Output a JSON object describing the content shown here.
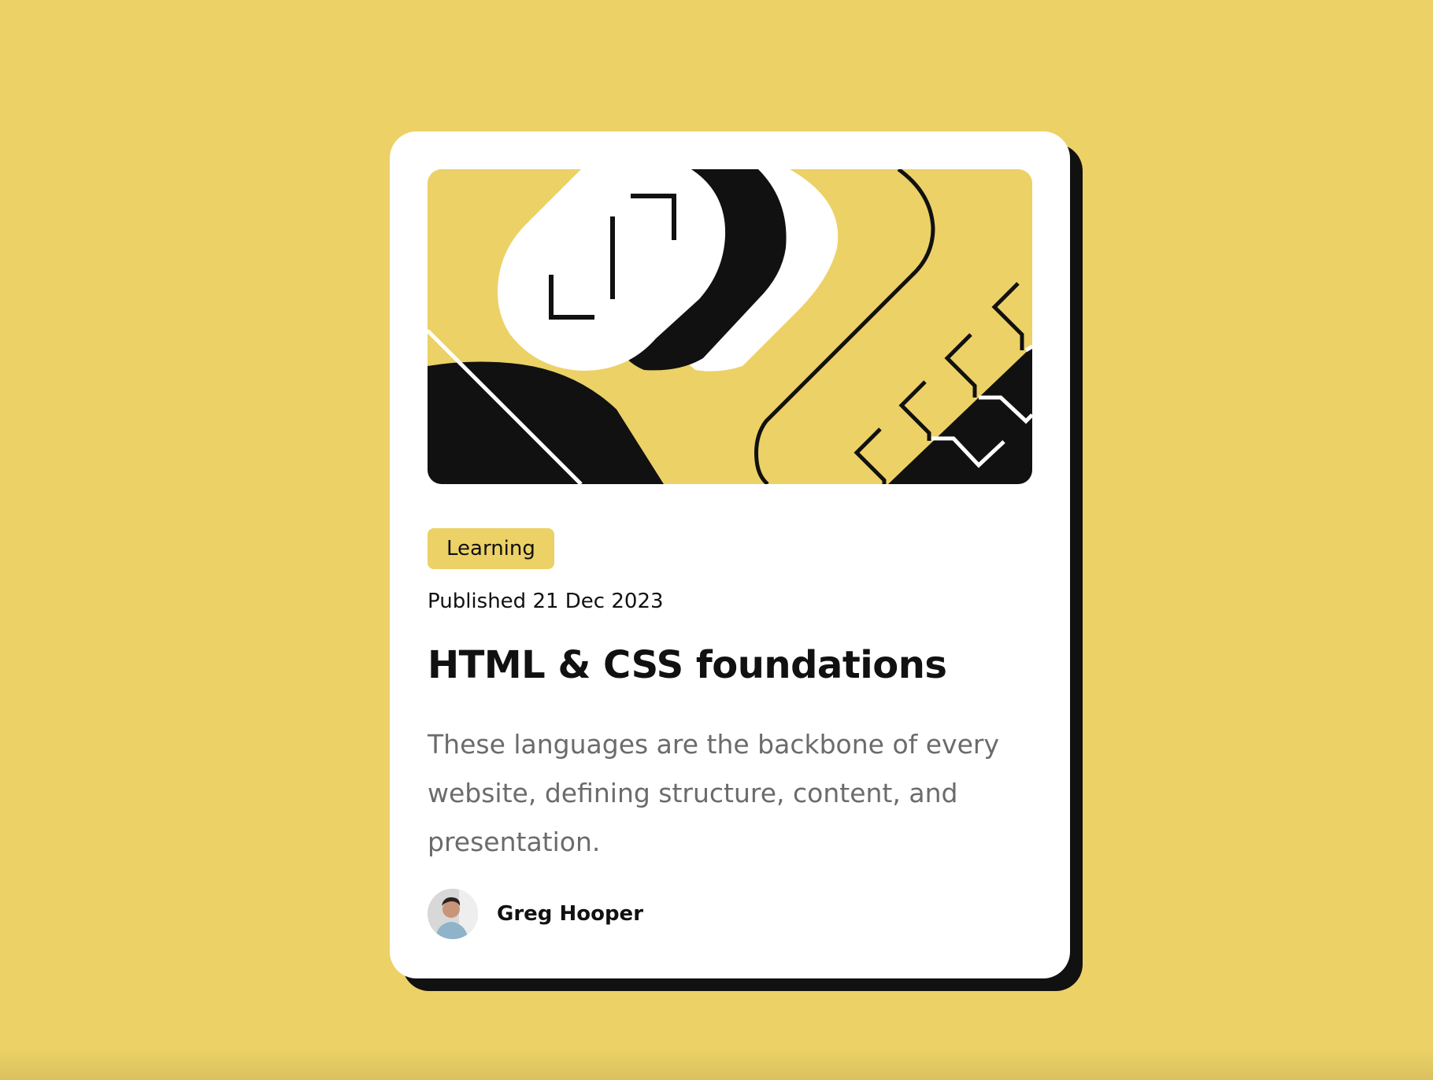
{
  "card": {
    "tag": "Learning",
    "published": "Published 21 Dec 2023",
    "title": "HTML & CSS foundations",
    "description": "These languages are the backbone of every website, defining structure, content, and presentation.",
    "author": {
      "name": "Greg Hooper"
    },
    "hero_icon": "abstract-yellow-black-illustration-icon"
  },
  "colors": {
    "background": "#ECD166",
    "card": "#FFFFFF",
    "text": "#111111",
    "muted_text": "#6B6B6B",
    "shadow": "#111111"
  }
}
